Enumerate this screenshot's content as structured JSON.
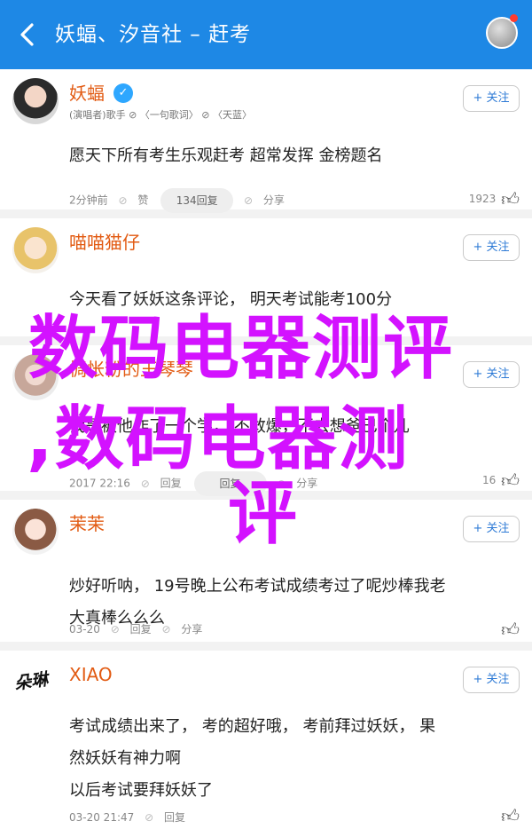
{
  "header": {
    "title": "妖蝠、汐音社 – 赶考"
  },
  "comments": [
    {
      "name": "妖蝠",
      "meta": "(演唱者)歌手 ⊘ 〈一句歌词〉 ⊘ 〈天蓝〉",
      "follow": "+ 关注",
      "text": [
        "愿天下所有考生乐观赶考  超常发挥  金榜题名"
      ],
      "time": "2分钟前",
      "action1": "赞",
      "pill": "134回复",
      "share": "分享",
      "likes": "1923"
    },
    {
      "name": "喵喵猫仔",
      "follow": "+ 关注",
      "text": [
        "今天看了妖妖这条评论，  明天考试能考100分"
      ]
    },
    {
      "name": "惆怅粉的王琴琴",
      "follow": "+ 关注",
      "text": [
        "我是被他作了一个学，  不敢爆，不去想爸已个儿"
      ],
      "time": "2017 22:16",
      "action1": "回复",
      "pill": "回复",
      "share": "分享",
      "likes": "16"
    },
    {
      "name": "茉茉",
      "follow": "+ 关注",
      "text": [
        "炒好听呐，  19号晚上公布考试成绩考过了呢炒棒我老",
        "大真棒么么么"
      ],
      "time": "03-20",
      "action1": "回复",
      "share": "分享"
    },
    {
      "name": "XIAO",
      "calligraphy": "朵琳",
      "follow": "+ 关注",
      "text": [
        "考试成绩出来了，  考的超好哦，  考前拜过妖妖，  果",
        "然妖妖有神力啊",
        "以后考试要拜妖妖了"
      ],
      "time": "03-20 21:47",
      "action1": "回复"
    }
  ],
  "overlay": {
    "line1": "数码电器测评",
    "line2": ",数码电器测",
    "line3": "评"
  }
}
